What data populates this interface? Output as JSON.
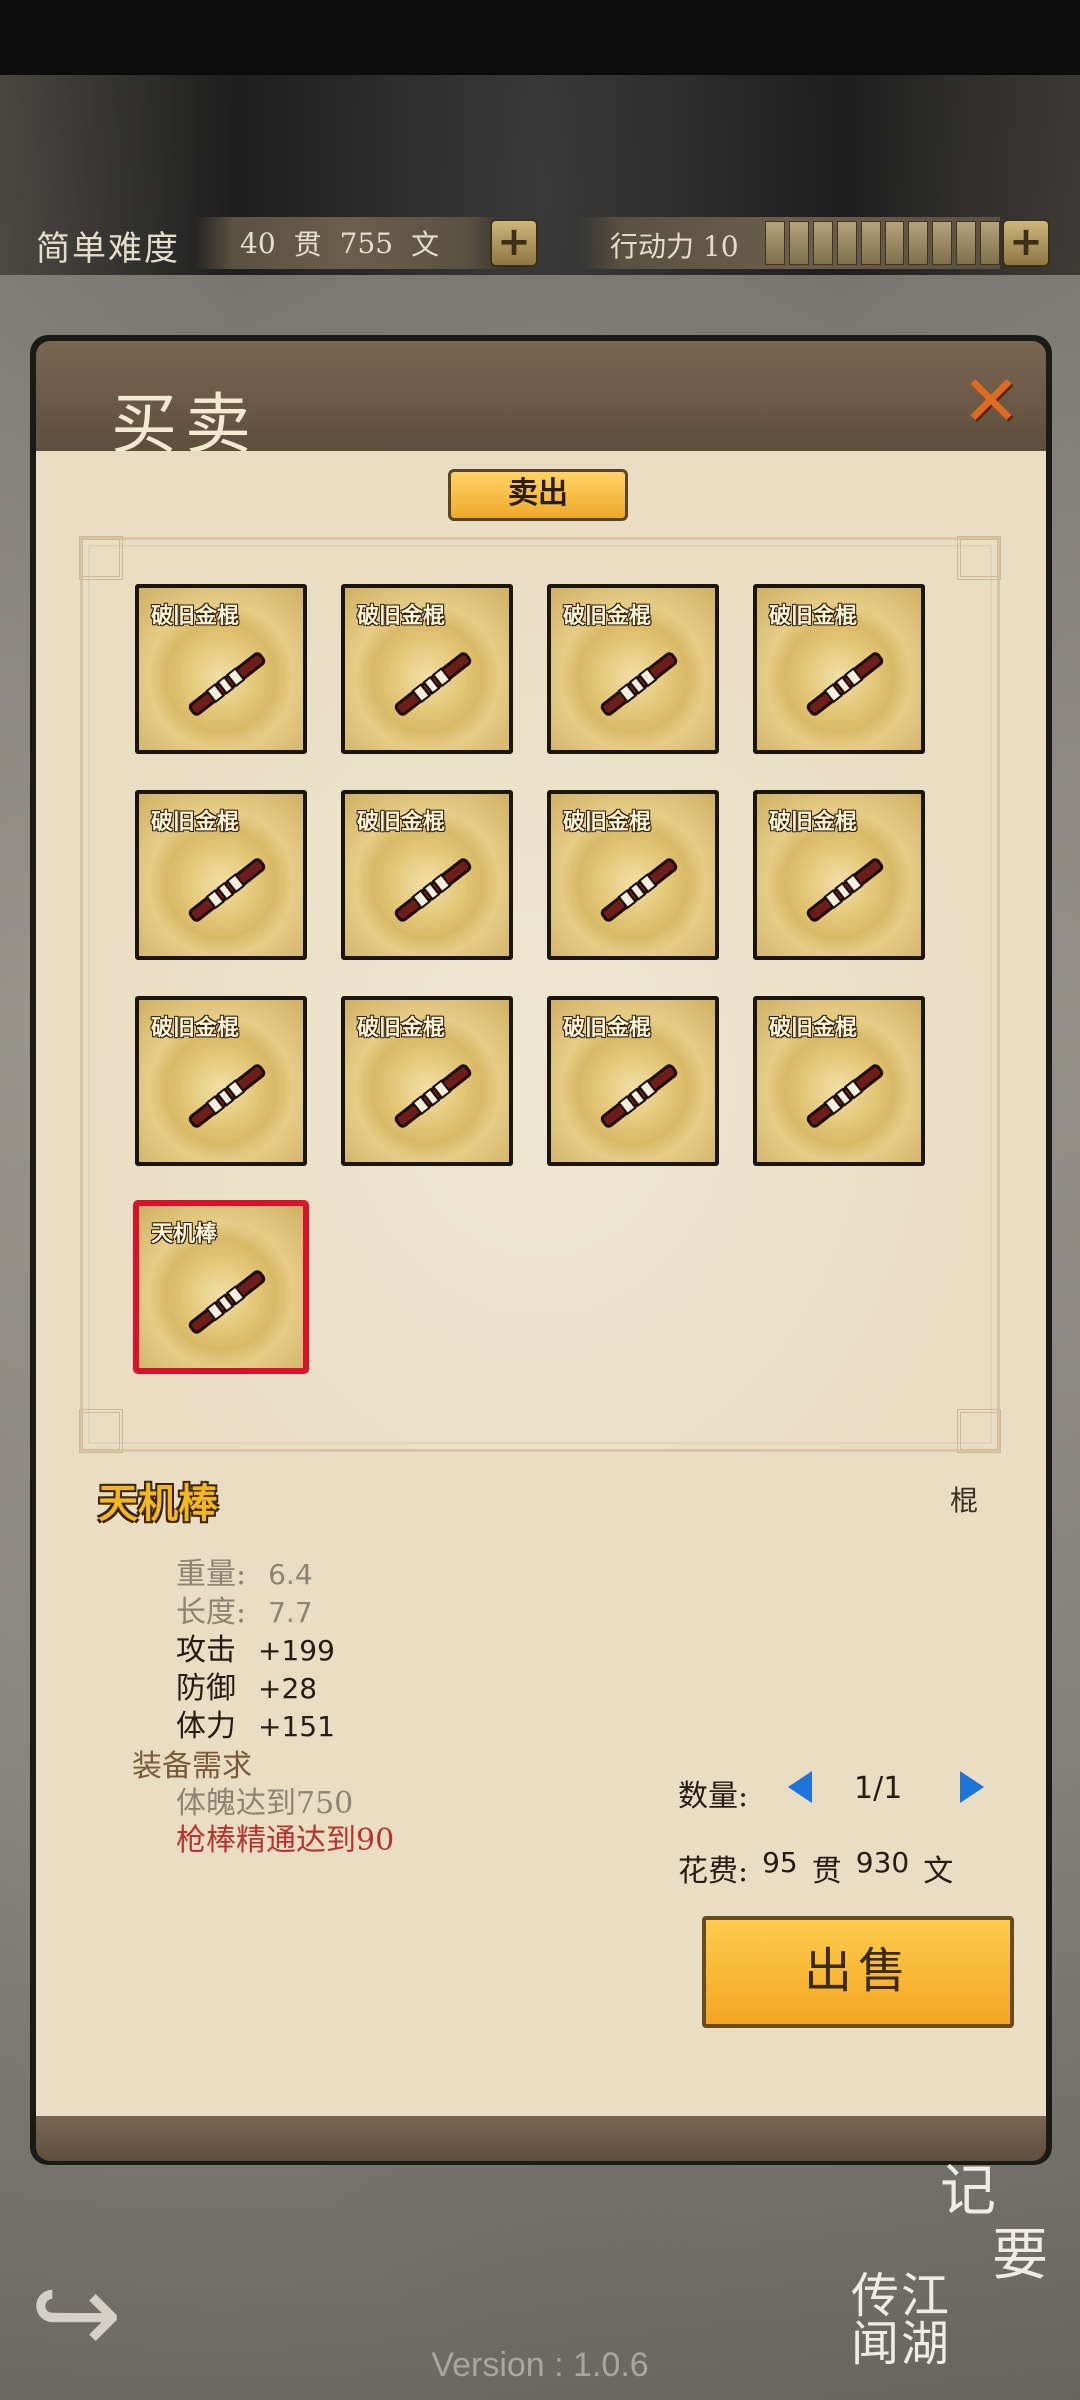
{
  "top_bar": {
    "difficulty": "简单难度",
    "money": {
      "guan": "40",
      "guan_unit": "贯",
      "wen": "755",
      "wen_unit": "文"
    },
    "action_label": "行动力 10",
    "energy_segments": 10
  },
  "panel": {
    "title": "买卖",
    "tab_sell": "卖出"
  },
  "items": [
    {
      "name": "破旧金棍",
      "selected": false
    },
    {
      "name": "破旧金棍",
      "selected": false
    },
    {
      "name": "破旧金棍",
      "selected": false
    },
    {
      "name": "破旧金棍",
      "selected": false
    },
    {
      "name": "破旧金棍",
      "selected": false
    },
    {
      "name": "破旧金棍",
      "selected": false
    },
    {
      "name": "破旧金棍",
      "selected": false
    },
    {
      "name": "破旧金棍",
      "selected": false
    },
    {
      "name": "破旧金棍",
      "selected": false
    },
    {
      "name": "破旧金棍",
      "selected": false
    },
    {
      "name": "破旧金棍",
      "selected": false
    },
    {
      "name": "破旧金棍",
      "selected": false
    },
    {
      "name": "天机棒",
      "selected": true
    }
  ],
  "detail": {
    "name": "天机棒",
    "type": "棍",
    "stats": [
      {
        "label": "重量:",
        "value": "6.4",
        "style": "dim"
      },
      {
        "label": "长度:",
        "value": "7.7",
        "style": "dim"
      },
      {
        "label": "攻击",
        "value": "+199",
        "style": "dark"
      },
      {
        "label": "防御",
        "value": "+28",
        "style": "dark"
      },
      {
        "label": "体力",
        "value": "+151",
        "style": "dark"
      }
    ],
    "req_title": "装备需求",
    "req1": "体魄达到750",
    "req2": "枪棒精通达到90"
  },
  "trade": {
    "qty_label": "数量:",
    "qty_value": "1/1",
    "cost_label": "花费:",
    "cost_guan": "95",
    "cost_guan_unit": "贯",
    "cost_wen": "930",
    "cost_wen_unit": "文",
    "sell_button": "出售"
  },
  "bottom": {
    "jiyao_1": "记",
    "jiyao_2": "要",
    "jianghu": "江湖传闻",
    "version": "Version : 1.0.6"
  },
  "colors": {
    "accent_gold": "#f2b823",
    "selected_border": "#d9112a",
    "requirement_unmet": "#b53432"
  }
}
